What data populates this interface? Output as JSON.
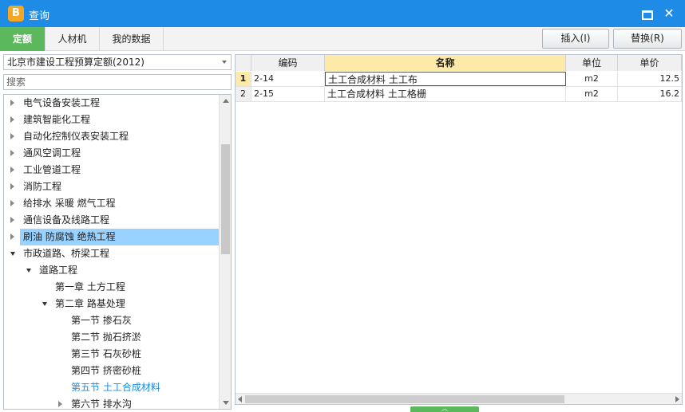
{
  "window": {
    "title": "查询",
    "logo_glyph": "B"
  },
  "tabs": [
    {
      "label": "定额",
      "active": true
    },
    {
      "label": "人材机",
      "active": false
    },
    {
      "label": "我的数据",
      "active": false
    }
  ],
  "toolbar": {
    "insert_label": "插入(I)",
    "replace_label": "替换(R)"
  },
  "left": {
    "quota_select": "北京市建设工程预算定额(2012)",
    "search_placeholder": "搜索"
  },
  "tree": [
    {
      "label": "电气设备安装工程",
      "level": 0,
      "toggle": "closed"
    },
    {
      "label": "建筑智能化工程",
      "level": 0,
      "toggle": "closed"
    },
    {
      "label": "自动化控制仪表安装工程",
      "level": 0,
      "toggle": "closed"
    },
    {
      "label": "通风空调工程",
      "level": 0,
      "toggle": "closed"
    },
    {
      "label": "工业管道工程",
      "level": 0,
      "toggle": "closed"
    },
    {
      "label": "消防工程",
      "level": 0,
      "toggle": "closed"
    },
    {
      "label": "给排水 采暖 燃气工程",
      "level": 0,
      "toggle": "closed"
    },
    {
      "label": "通信设备及线路工程",
      "level": 0,
      "toggle": "closed"
    },
    {
      "label": "刷油 防腐蚀 绝热工程",
      "level": 0,
      "toggle": "closed",
      "selected": true
    },
    {
      "label": "市政道路、桥梁工程",
      "level": 0,
      "toggle": "open"
    },
    {
      "label": "道路工程",
      "level": 1,
      "toggle": "open"
    },
    {
      "label": "第一章 土方工程",
      "level": 2,
      "toggle": "none"
    },
    {
      "label": "第二章 路基处理",
      "level": 2,
      "toggle": "open"
    },
    {
      "label": "第一节 掺石灰",
      "level": 3,
      "toggle": "none"
    },
    {
      "label": "第二节 抛石挤淤",
      "level": 3,
      "toggle": "none"
    },
    {
      "label": "第三节 石灰砂桩",
      "level": 3,
      "toggle": "none"
    },
    {
      "label": "第四节 挤密砂桩",
      "level": 3,
      "toggle": "none"
    },
    {
      "label": "第五节 土工合成材料",
      "level": 3,
      "toggle": "none",
      "highlight": true
    },
    {
      "label": "第六节 排水沟",
      "level": 3,
      "toggle": "closed"
    }
  ],
  "table": {
    "headers": {
      "num": "",
      "code": "编码",
      "name": "名称",
      "unit": "单位",
      "price": "单价"
    },
    "rows": [
      {
        "num": "1",
        "code": "2-14",
        "name": "土工合成材料 土工布",
        "unit": "m2",
        "price": "12.5"
      },
      {
        "num": "2",
        "code": "2-15",
        "name": "土工合成材料 土工格栅",
        "unit": "m2",
        "price": "16.2"
      }
    ]
  },
  "colors": {
    "titlebar": "#1e8ce6",
    "active_tab": "#5cb85c",
    "selected_row": "#99d1ff",
    "highlight_text": "#1a8be0",
    "header_highlight": "#fde9a8"
  },
  "icons": {
    "min": "minimize-icon",
    "close": "close-icon"
  }
}
